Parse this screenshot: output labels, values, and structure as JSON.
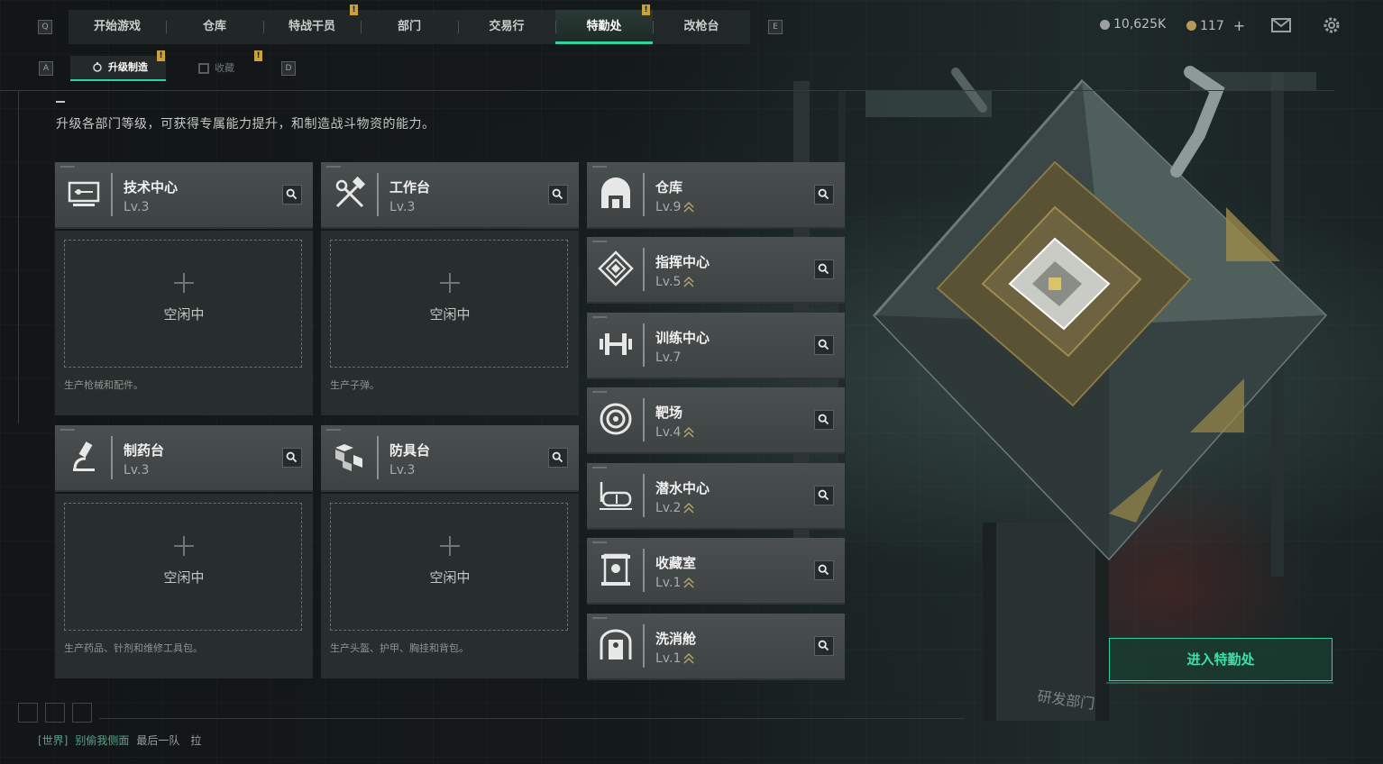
{
  "top_nav": {
    "left_key": "Q",
    "right_key": "E",
    "tabs": [
      {
        "label": "开始游戏",
        "alert": false
      },
      {
        "label": "仓库",
        "alert": false
      },
      {
        "label": "特战干员",
        "alert": true
      },
      {
        "label": "部门",
        "alert": false
      },
      {
        "label": "交易行",
        "alert": false
      },
      {
        "label": "特勤处",
        "alert": true,
        "active": true
      },
      {
        "label": "改枪台",
        "alert": false
      }
    ],
    "currency_main": "10,625K",
    "currency_premium": "117",
    "add_label": "+"
  },
  "sub_nav": {
    "left_key": "A",
    "right_key": "D",
    "tabs": [
      {
        "label": "升级制造",
        "active": true
      },
      {
        "label": "收藏",
        "active": false
      }
    ]
  },
  "intro_text": "升级各部门等级，可获得专属能力提升，和制造战斗物资的能力。",
  "craft_stations": [
    {
      "name": "技术中心",
      "level": "Lv.3",
      "icon": "tech-center-icon",
      "idle": "空闲中",
      "desc": "生产枪械和配件。"
    },
    {
      "name": "工作台",
      "level": "Lv.3",
      "icon": "workbench-icon",
      "idle": "空闲中",
      "desc": "生产子弹。"
    },
    {
      "name": "制药台",
      "level": "Lv.3",
      "icon": "pharmacy-icon",
      "idle": "空闲中",
      "desc": "生产药品、针剂和维修工具包。"
    },
    {
      "name": "防具台",
      "level": "Lv.3",
      "icon": "armor-bench-icon",
      "idle": "空闲中",
      "desc": "生产头盔、护甲、胸挂和背包。"
    }
  ],
  "facilities": [
    {
      "name": "仓库",
      "level": "Lv.9",
      "icon": "warehouse-icon",
      "upgrade": true
    },
    {
      "name": "指挥中心",
      "level": "Lv.5",
      "icon": "command-center-icon",
      "upgrade": true
    },
    {
      "name": "训练中心",
      "level": "Lv.7",
      "icon": "training-center-icon",
      "upgrade": false
    },
    {
      "name": "靶场",
      "level": "Lv.4",
      "icon": "shooting-range-icon",
      "upgrade": true
    },
    {
      "name": "潜水中心",
      "level": "Lv.2",
      "icon": "diving-center-icon",
      "upgrade": true
    },
    {
      "name": "收藏室",
      "level": "Lv.1",
      "icon": "collection-room-icon",
      "upgrade": true
    },
    {
      "name": "洗消舱",
      "level": "Lv.1",
      "icon": "decon-chamber-icon",
      "upgrade": true
    }
  ],
  "enter_button": "进入特勤处",
  "chat": {
    "channel": "[世界]",
    "sender": "别偷我侧面",
    "message": "最后一队　拉"
  },
  "colors": {
    "accent": "#2fd39b",
    "alert": "#c9a23a",
    "upgrade_arrow": "#b8a36a"
  }
}
